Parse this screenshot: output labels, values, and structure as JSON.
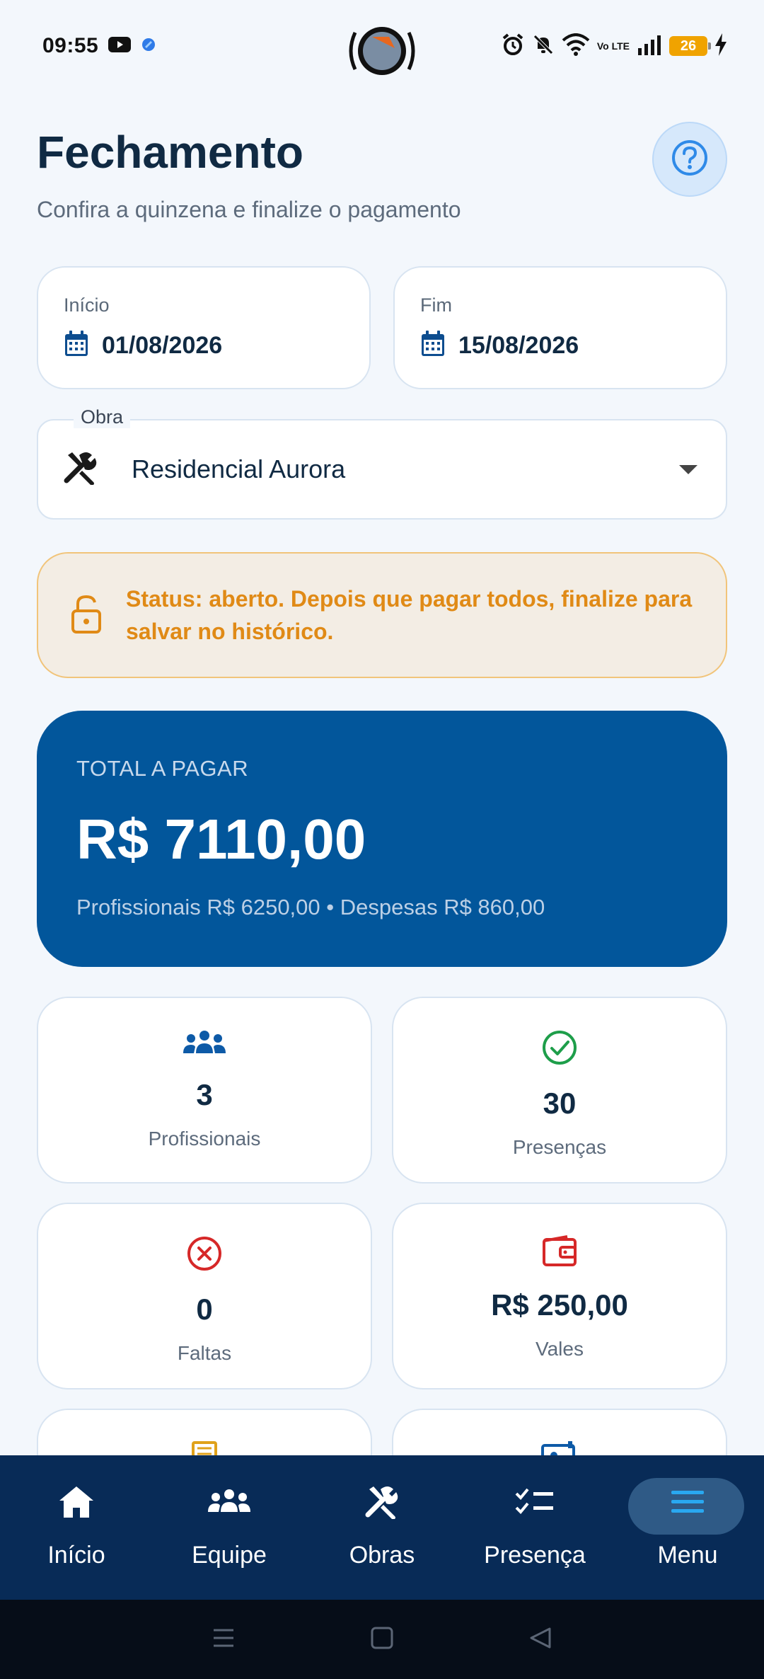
{
  "status_bar": {
    "time": "09:55",
    "battery": "26",
    "network": "Vo LTE"
  },
  "header": {
    "title": "Fechamento",
    "subtitle": "Confira a quinzena e finalize o pagamento"
  },
  "dates": {
    "start": {
      "label": "Início",
      "value": "01/08/2026"
    },
    "end": {
      "label": "Fim",
      "value": "15/08/2026"
    }
  },
  "obra": {
    "label": "Obra",
    "value": "Residencial Aurora"
  },
  "alert": {
    "text": "Status: aberto. Depois que pagar todos, finalize para salvar no histórico."
  },
  "total": {
    "label": "TOTAL A PAGAR",
    "value": "R$ 7110,00",
    "breakdown": "Profissionais R$ 6250,00 • Despesas R$ 860,00"
  },
  "stats": [
    {
      "value": "3",
      "label": "Profissionais",
      "icon": "people-icon",
      "color": "#0d5aa7"
    },
    {
      "value": "30",
      "label": "Presenças",
      "icon": "check-circle-icon",
      "color": "#1e9e4a"
    },
    {
      "value": "0",
      "label": "Faltas",
      "icon": "x-circle-icon",
      "color": "#d62828"
    },
    {
      "value": "R$ 250,00",
      "label": "Vales",
      "icon": "wallet-icon",
      "color": "#d62828"
    }
  ],
  "bottom_nav": [
    {
      "label": "Início",
      "icon": "home-icon"
    },
    {
      "label": "Equipe",
      "icon": "people-icon"
    },
    {
      "label": "Obras",
      "icon": "tools-icon"
    },
    {
      "label": "Presença",
      "icon": "checklist-icon"
    },
    {
      "label": "Menu",
      "icon": "menu-icon",
      "active": true
    }
  ],
  "colors": {
    "primary": "#02569b",
    "nav_bg": "#082b57",
    "alert_text": "#e08a16",
    "accent": "#29a8f0"
  }
}
